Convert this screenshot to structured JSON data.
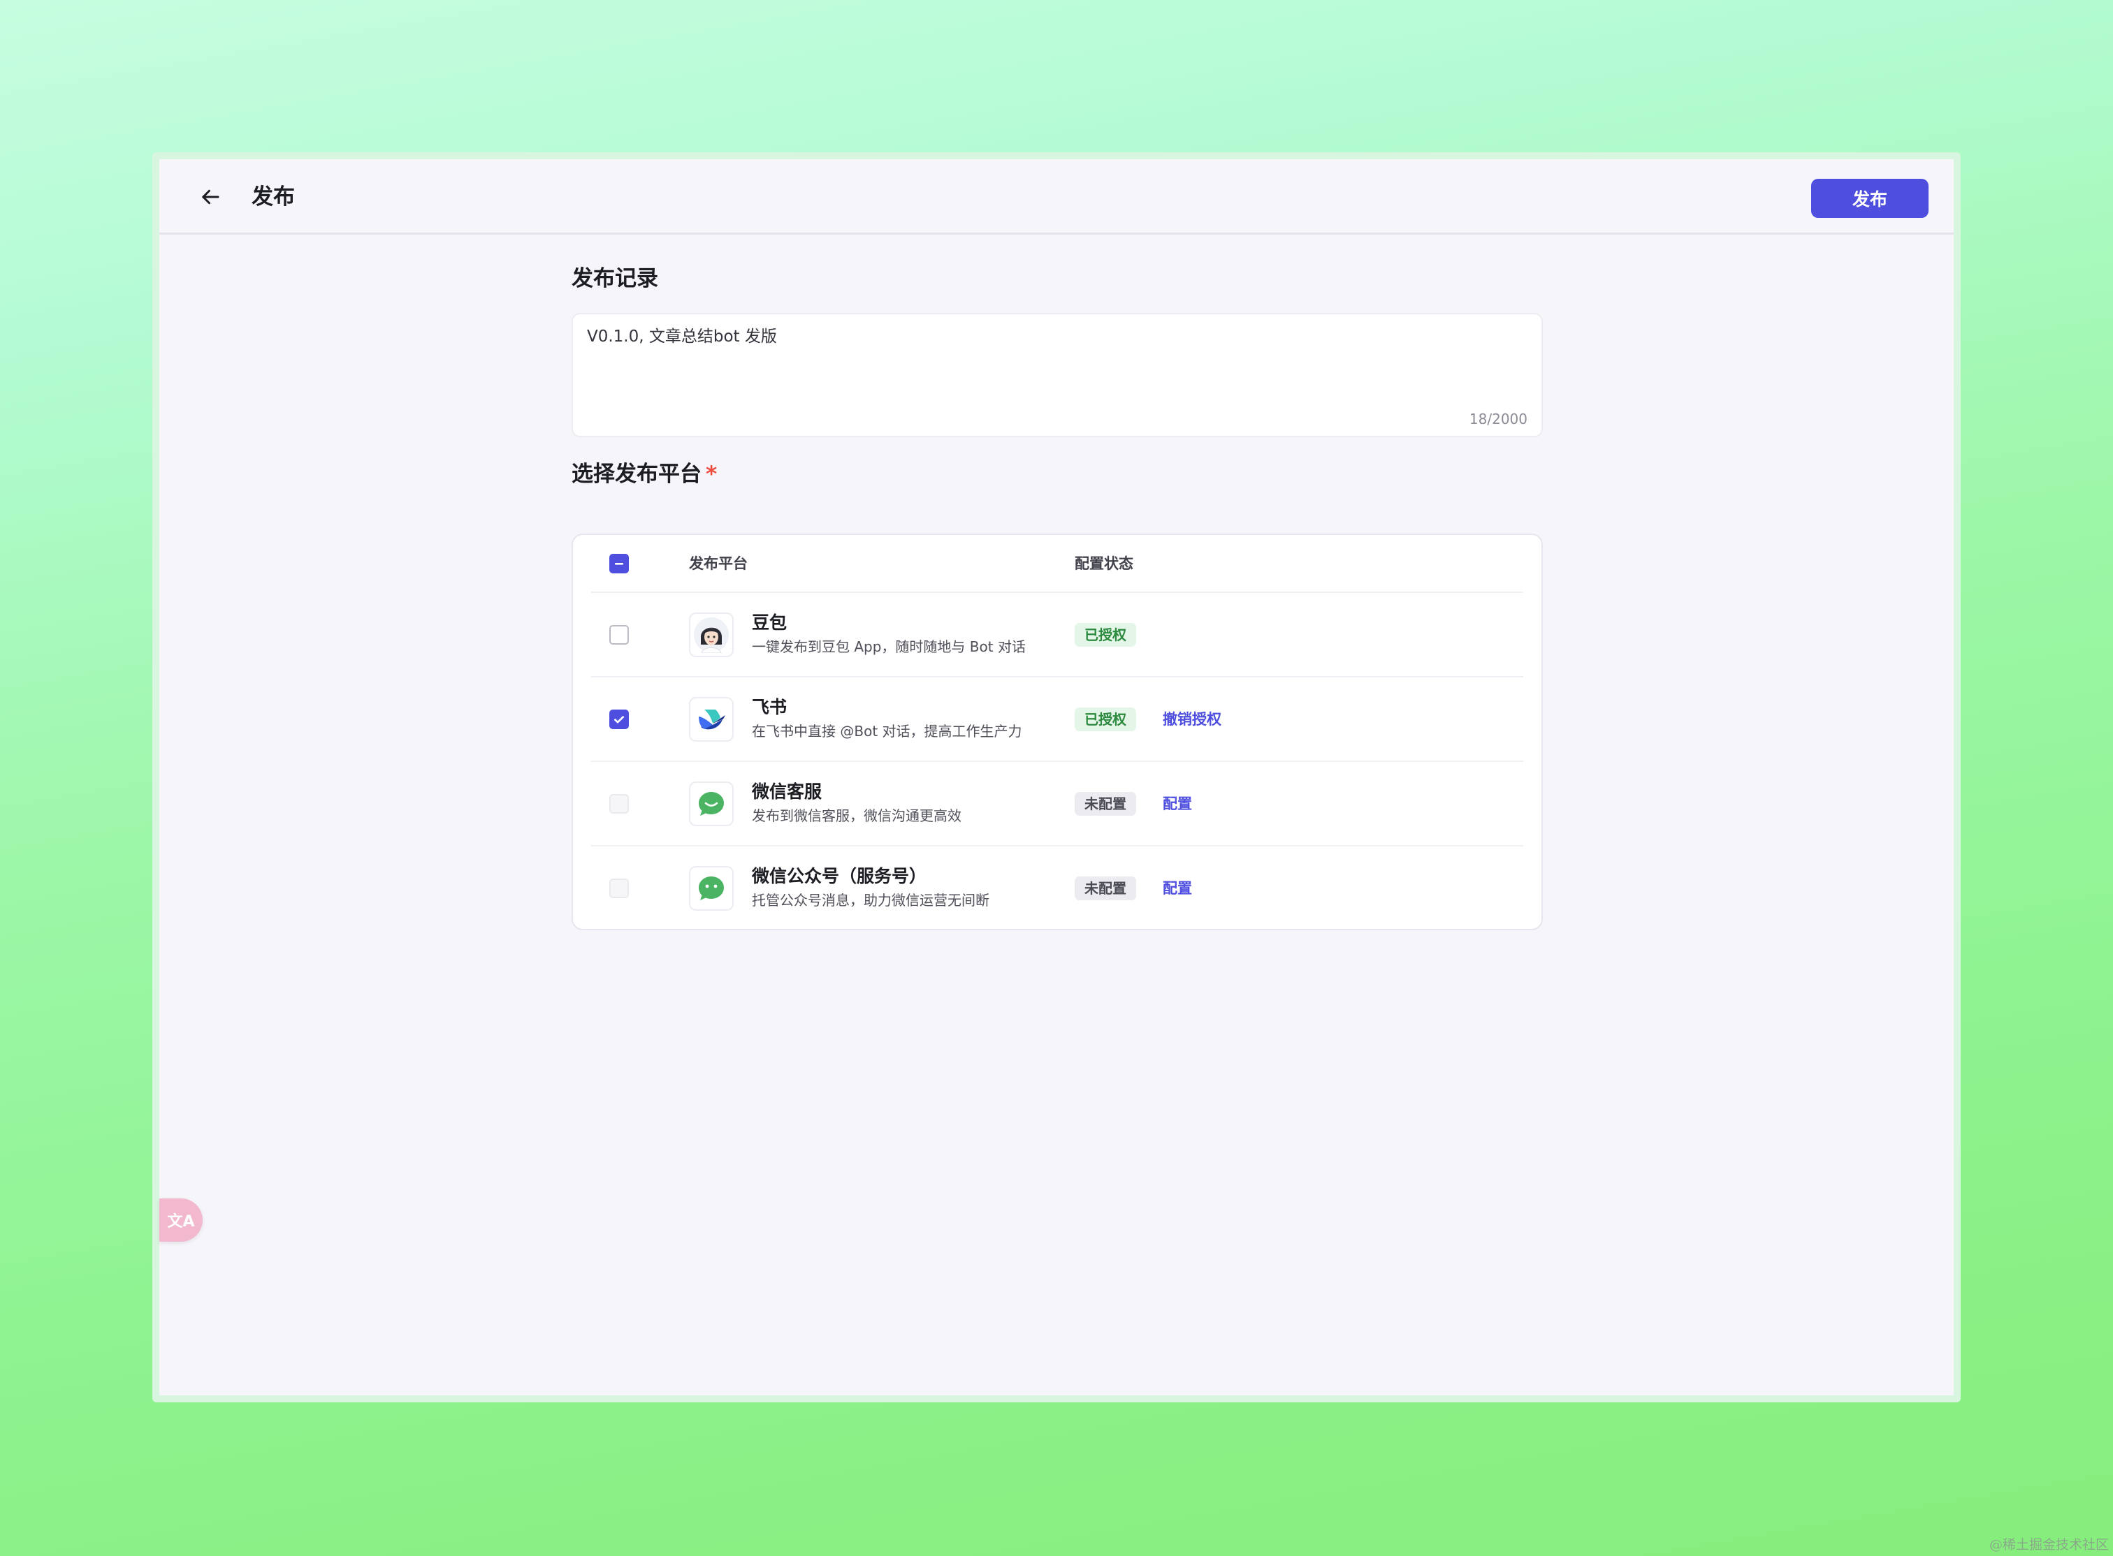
{
  "header": {
    "title": "发布",
    "publish_button": "发布"
  },
  "record": {
    "section_title": "发布记录",
    "text": "V0.1.0, 文章总结bot 发版",
    "counter": "18/2000"
  },
  "platforms": {
    "section_title": "选择发布平台",
    "required_mark": "*",
    "columns": {
      "platform": "发布平台",
      "status": "配置状态"
    },
    "select_all_state": "indeterminate",
    "items": [
      {
        "name": "豆包",
        "desc": "一键发布到豆包 App，随时随地与 Bot 对话",
        "status": "已授权",
        "status_type": "ok",
        "action": "",
        "checked": false,
        "disabled": false,
        "icon": "doubao-avatar-icon"
      },
      {
        "name": "飞书",
        "desc": "在飞书中直接 @Bot 对话，提高工作生产力",
        "status": "已授权",
        "status_type": "ok",
        "action": "撤销授权",
        "checked": true,
        "disabled": false,
        "icon": "feishu-icon"
      },
      {
        "name": "微信客服",
        "desc": "发布到微信客服，微信沟通更高效",
        "status": "未配置",
        "status_type": "no",
        "action": "配置",
        "checked": false,
        "disabled": true,
        "icon": "wechat-kefu-icon"
      },
      {
        "name": "微信公众号（服务号）",
        "desc": "托管公众号消息，助力微信运营无间断",
        "status": "未配置",
        "status_type": "no",
        "action": "配置",
        "checked": false,
        "disabled": true,
        "icon": "wechat-official-icon"
      }
    ]
  },
  "colors": {
    "accent": "#4f4fdf",
    "ok_bg": "#e4f6e8",
    "ok_text": "#2c8a3f",
    "wechat_green": "#4bb463"
  },
  "floating": {
    "translate_label": "文A"
  },
  "watermark": "@稀土掘金技术社区"
}
